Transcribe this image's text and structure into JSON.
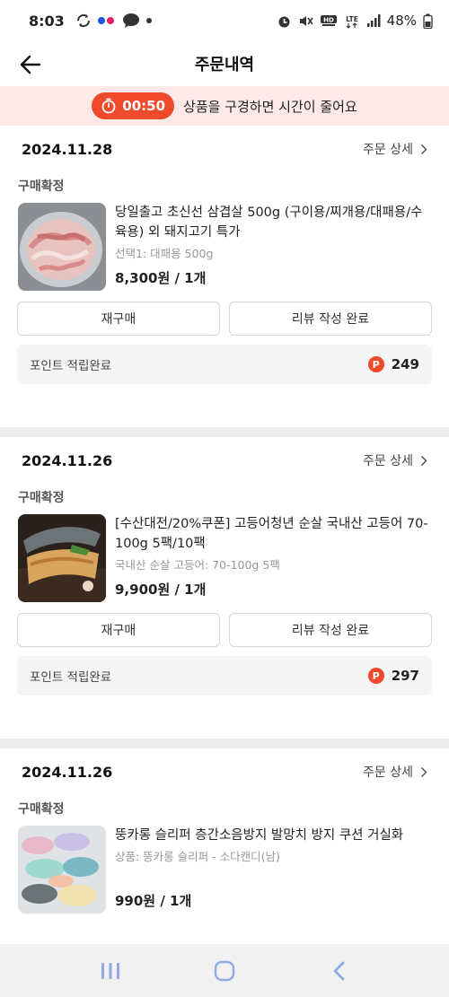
{
  "status_bar": {
    "time": "8:03",
    "battery": "48%",
    "icons": [
      "sync-icon",
      "app-dots-icon",
      "chat-icon",
      "dot-icon",
      "alarm-icon",
      "mute-icon",
      "hd-voice-icon",
      "lte-icon",
      "signal-icon",
      "battery-icon"
    ]
  },
  "header": {
    "title": "주문내역",
    "back_icon": "arrow-left-icon"
  },
  "banner": {
    "timer": "00:50",
    "text": "상품을 구경하면 시간이 줄어요",
    "accent": "#f04a2c",
    "bg": "#fde9e7"
  },
  "orders": [
    {
      "date": "2024.11.28",
      "detail_label": "주문 상세",
      "status": "구매확정",
      "product_name": "당일출고 초신선 삼겹살 500g (구이용/찌개용/대패용/수육용) 외 돼지고기 특가",
      "option": "선택1: 대패용 500g",
      "price": "8,300원 / 1개",
      "rebuy_label": "재구매",
      "review_label": "리뷰 작성 완료",
      "points_label": "포인트 적립완료",
      "points_value": "249",
      "points_badge": "P"
    },
    {
      "date": "2024.11.26",
      "detail_label": "주문 상세",
      "status": "구매확정",
      "product_name": "[수산대전/20%쿠폰] 고등어청년 순살 국내산 고등어 70-100g 5팩/10팩",
      "option": "국내산 순살 고등어: 70-100g 5팩",
      "price": "9,900원 / 1개",
      "rebuy_label": "재구매",
      "review_label": "리뷰 작성 완료",
      "points_label": "포인트 적립완료",
      "points_value": "297",
      "points_badge": "P"
    },
    {
      "date": "2024.11.26",
      "detail_label": "주문 상세",
      "status": "구매확정",
      "product_name": "뚱카롱 슬리퍼 층간소음방지 발망치 방지 쿠션 거실화",
      "option": "상품: 뚱카롱 슬리퍼 - 소다캔디(남)",
      "price": "990원 / 1개"
    }
  ],
  "nav_bar": {
    "icons": [
      "recent-apps-icon",
      "home-icon",
      "back-icon"
    ],
    "accent": "#8fa8e8"
  }
}
